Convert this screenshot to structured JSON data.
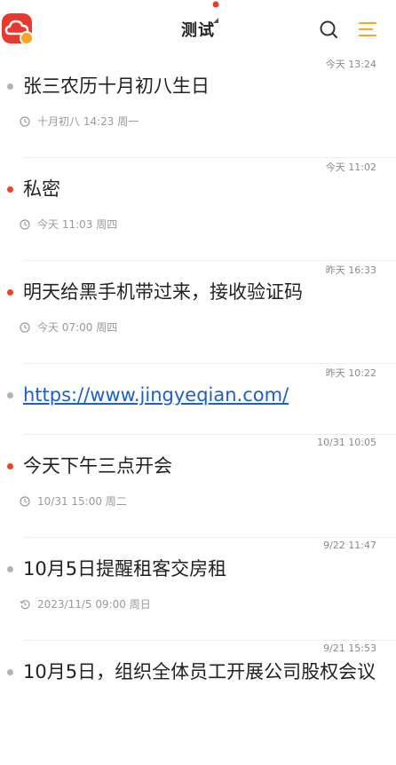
{
  "header": {
    "title": "测试",
    "logo_icon": "cloud-note-logo-icon",
    "search_icon": "search-icon",
    "menu_icon": "menu-icon",
    "accent_color": "#f5a623",
    "brand_color": "#e8392f"
  },
  "notes": [
    {
      "time": "今天 13:24",
      "text": "张三农历十月初八生日",
      "reminder": "十月初八 14:23 周一",
      "dot_color": "#b3b3b3",
      "reminder_icon": "clock-icon",
      "is_link": false
    },
    {
      "time": "今天 11:02",
      "text": "私密",
      "reminder": "今天 11:03 周四",
      "dot_color": "#e8452f",
      "reminder_icon": "clock-icon",
      "is_link": false
    },
    {
      "time": "昨天 16:33",
      "text": "明天给黑手机带过来，接收验证码",
      "reminder": "今天 07:00 周四",
      "dot_color": "#e8452f",
      "reminder_icon": "clock-icon",
      "is_link": false
    },
    {
      "time": "昨天 10:22",
      "text": "https://www.jingyeqian.com/",
      "reminder": "",
      "dot_color": "#b3b3b3",
      "reminder_icon": "",
      "is_link": true
    },
    {
      "time": "10/31 10:05",
      "text": "今天下午三点开会",
      "reminder": "10/31 15:00 周二",
      "dot_color": "#e8452f",
      "reminder_icon": "clock-icon",
      "is_link": false
    },
    {
      "time": "9/22 11:47",
      "text": "10月5日提醒租客交房租",
      "reminder": "2023/11/5 09:00 周日",
      "dot_color": "#b3b3b3",
      "reminder_icon": "repeat-clock-icon",
      "is_link": false
    },
    {
      "time": "9/21 15:53",
      "text": "10月5日，组织全体员工开展公司股权会议",
      "reminder": "",
      "dot_color": "#b3b3b3",
      "reminder_icon": "",
      "is_link": false
    }
  ]
}
